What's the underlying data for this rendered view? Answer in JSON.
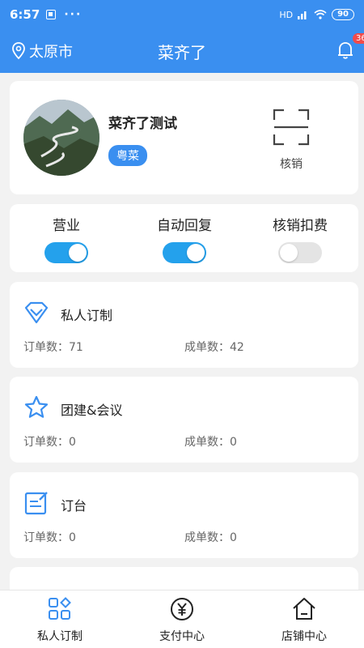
{
  "status": {
    "time": "6:57",
    "dots": "···",
    "network": "HD",
    "battery": "90"
  },
  "header": {
    "city": "太原市",
    "title": "菜齐了",
    "notification_count": "36"
  },
  "profile": {
    "name": "菜齐了测试",
    "cuisine": "粤菜",
    "verify_label": "核销"
  },
  "switches": [
    {
      "label": "营业",
      "on": true
    },
    {
      "label": "自动回复",
      "on": true
    },
    {
      "label": "核销扣费",
      "on": false
    }
  ],
  "services": [
    {
      "name": "私人订制",
      "icon": "diamond-icon",
      "orders_label": "订单数：71",
      "deals_label": "成单数：42"
    },
    {
      "name": "团建&会议",
      "icon": "star-icon",
      "orders_label": "订单数：0",
      "deals_label": "成单数：0"
    },
    {
      "name": "订台",
      "icon": "edit-icon",
      "orders_label": "订单数：0",
      "deals_label": "成单数：0"
    }
  ],
  "tabs": [
    {
      "label": "私人订制",
      "icon": "grid-icon"
    },
    {
      "label": "支付中心",
      "icon": "yen-icon"
    },
    {
      "label": "店铺中心",
      "icon": "home-icon"
    }
  ],
  "colors": {
    "primary": "#3a8ff0",
    "toggle_on": "#24a1ec",
    "badge": "#f24b4b"
  }
}
